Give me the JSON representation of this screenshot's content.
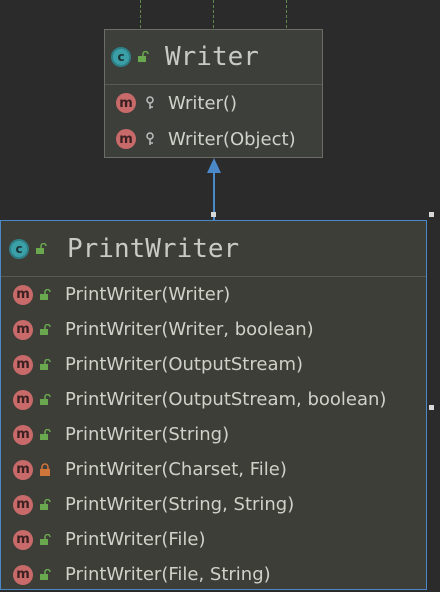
{
  "writer": {
    "title": "Writer",
    "class_icon": "class-icon",
    "methods": [
      {
        "label": "Writer()",
        "icon": "method-icon",
        "visibility": "protected-key-icon"
      },
      {
        "label": "Writer(Object)",
        "icon": "method-icon",
        "visibility": "protected-key-icon"
      }
    ]
  },
  "printwriter": {
    "title": "PrintWriter",
    "class_icon": "class-icon",
    "methods": [
      {
        "label": "PrintWriter(Writer)",
        "visibility": "public"
      },
      {
        "label": "PrintWriter(Writer, boolean)",
        "visibility": "public"
      },
      {
        "label": "PrintWriter(OutputStream)",
        "visibility": "public"
      },
      {
        "label": "PrintWriter(OutputStream, boolean)",
        "visibility": "public"
      },
      {
        "label": "PrintWriter(String)",
        "visibility": "public"
      },
      {
        "label": "PrintWriter(Charset, File)",
        "visibility": "private"
      },
      {
        "label": "PrintWriter(String, String)",
        "visibility": "public"
      },
      {
        "label": "PrintWriter(File)",
        "visibility": "public"
      },
      {
        "label": "PrintWriter(File, String)",
        "visibility": "public"
      }
    ]
  },
  "colors": {
    "background": "#2b2b2b",
    "method_badge": "#c86a6a",
    "class_badge": "#3b9fa8",
    "public_lock": "#6aa84f",
    "private_lock": "#d1763b",
    "selection_border": "#4a88c7",
    "arrow": "#4a88c7"
  }
}
